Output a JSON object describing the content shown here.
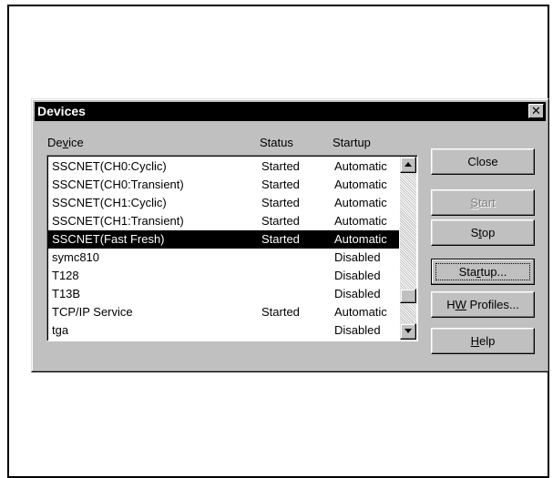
{
  "dialog": {
    "title": "Devices",
    "close_glyph": "✕",
    "columns": {
      "device_pre": "De",
      "device_acc": "v",
      "device_post": "ice",
      "status": "Status",
      "startup": "Startup"
    },
    "rows": [
      {
        "device": "SSCNET(CH0:Cyclic)",
        "status": "Started",
        "startup": "Automatic"
      },
      {
        "device": "SSCNET(CH0:Transient)",
        "status": "Started",
        "startup": "Automatic"
      },
      {
        "device": "SSCNET(CH1:Cyclic)",
        "status": "Started",
        "startup": "Automatic"
      },
      {
        "device": "SSCNET(CH1:Transient)",
        "status": "Started",
        "startup": "Automatic"
      },
      {
        "device": "SSCNET(Fast Fresh)",
        "status": "Started",
        "startup": "Automatic",
        "selected": true
      },
      {
        "device": "symc810",
        "status": "",
        "startup": "Disabled"
      },
      {
        "device": "T128",
        "status": "",
        "startup": "Disabled"
      },
      {
        "device": "T13B",
        "status": "",
        "startup": "Disabled"
      },
      {
        "device": "TCP/IP Service",
        "status": "Started",
        "startup": "Automatic"
      },
      {
        "device": "tga",
        "status": "",
        "startup": "Disabled"
      }
    ],
    "buttons": {
      "close": "Close",
      "start_acc": "S",
      "start_post": "tart",
      "stop_pre": "S",
      "stop_acc": "t",
      "stop_post": "op",
      "startup_pre": "Sta",
      "startup_acc": "r",
      "startup_post": "tup...",
      "hw_pre": "H",
      "hw_acc": "W",
      "hw_post": " Profiles...",
      "help_acc": "H",
      "help_post": "elp"
    },
    "scroll_position": 0.85
  }
}
